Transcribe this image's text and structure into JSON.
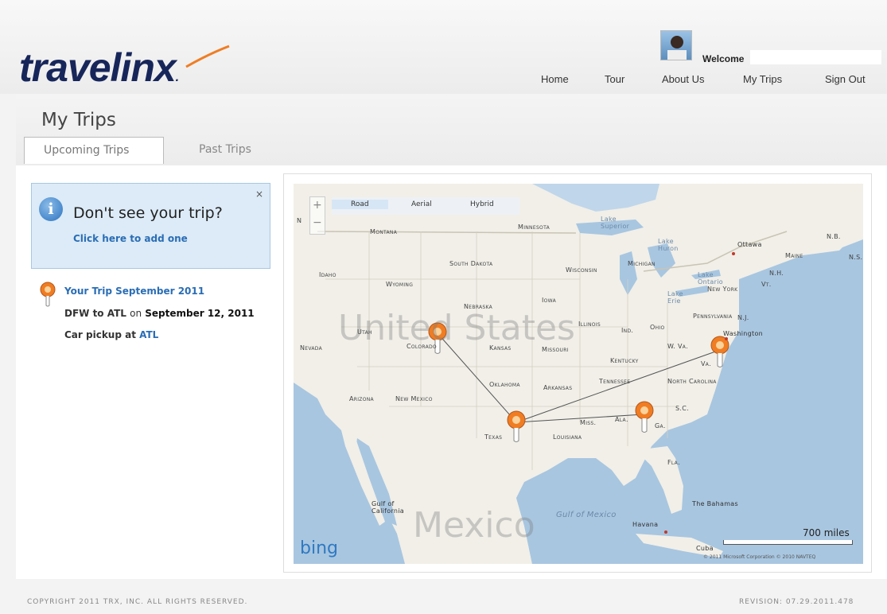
{
  "header": {
    "logo_text": "travelin",
    "logo_x": "x",
    "logo_dot": ".",
    "welcome_label": "Welcome",
    "nav": [
      {
        "label": "Home"
      },
      {
        "label": "Tour"
      },
      {
        "label": "About Us"
      },
      {
        "label": "My Trips"
      },
      {
        "label": "Sign Out"
      }
    ]
  },
  "page": {
    "title": "My Trips",
    "tabs": [
      {
        "label": "Upcoming Trips",
        "active": true
      },
      {
        "label": "Past Trips",
        "active": false
      }
    ]
  },
  "notice": {
    "title": "Don't see your trip?",
    "link": "Click here to add one",
    "close": "×"
  },
  "trip": {
    "title": "Your Trip September 2011",
    "route_prefix": "DFW to ATL",
    "route_on": "on",
    "route_date": "September 12, 2011",
    "car_prefix": "Car pickup at",
    "car_location": "ATL"
  },
  "map": {
    "tabs": [
      "Road",
      "Aerial",
      "Hybrid"
    ],
    "active_tab": "Road",
    "zoom_in": "+",
    "zoom_out": "−",
    "scale": "700 miles",
    "copyright": "© 2011 Microsoft Corporation   © 2010 NAVTEQ",
    "brand": "bing",
    "labels": {
      "country_us": "United States",
      "country_mx": "Mexico",
      "gulf": "Gulf of Mexico",
      "gulf_ca": "Gulf of California",
      "bahamas": "The Bahamas",
      "havana": "Havana",
      "cuba": "Cuba",
      "ottawa": "Ottawa",
      "washington": "Washington",
      "states": [
        "Montana",
        "Idaho",
        "Wyoming",
        "Nevada",
        "Utah",
        "Colorado",
        "Arizona",
        "New Mexico",
        "Texas",
        "Oklahoma",
        "Kansas",
        "Nebraska",
        "South Dakota",
        "Minnesota",
        "Wisconsin",
        "Iowa",
        "Missouri",
        "Arkansas",
        "Louisiana",
        "Miss.",
        "Ala.",
        "Ga.",
        "Fla.",
        "S.C.",
        "North Carolina",
        "Tennessee",
        "Kentucky",
        "Illinois",
        "Ind.",
        "Ohio",
        "W. Va.",
        "Va.",
        "Pennsylvania",
        "New York",
        "Michigan",
        "Maine",
        "N.H.",
        "Vt.",
        "N.J.",
        "N.B.",
        "N.S.",
        "N",
        "Lake Superior",
        "Lake Huron",
        "Lake Ontario",
        "Lake Erie"
      ]
    },
    "colors": {
      "water": "#a8c6e0",
      "land": "#f1efe8",
      "pin": "#f07d23"
    }
  },
  "footer": {
    "copyright": "COPYRIGHT 2011 TRX, INC. ALL RIGHTS RESERVED.",
    "revision": "REVISION: 07.29.2011.478"
  }
}
